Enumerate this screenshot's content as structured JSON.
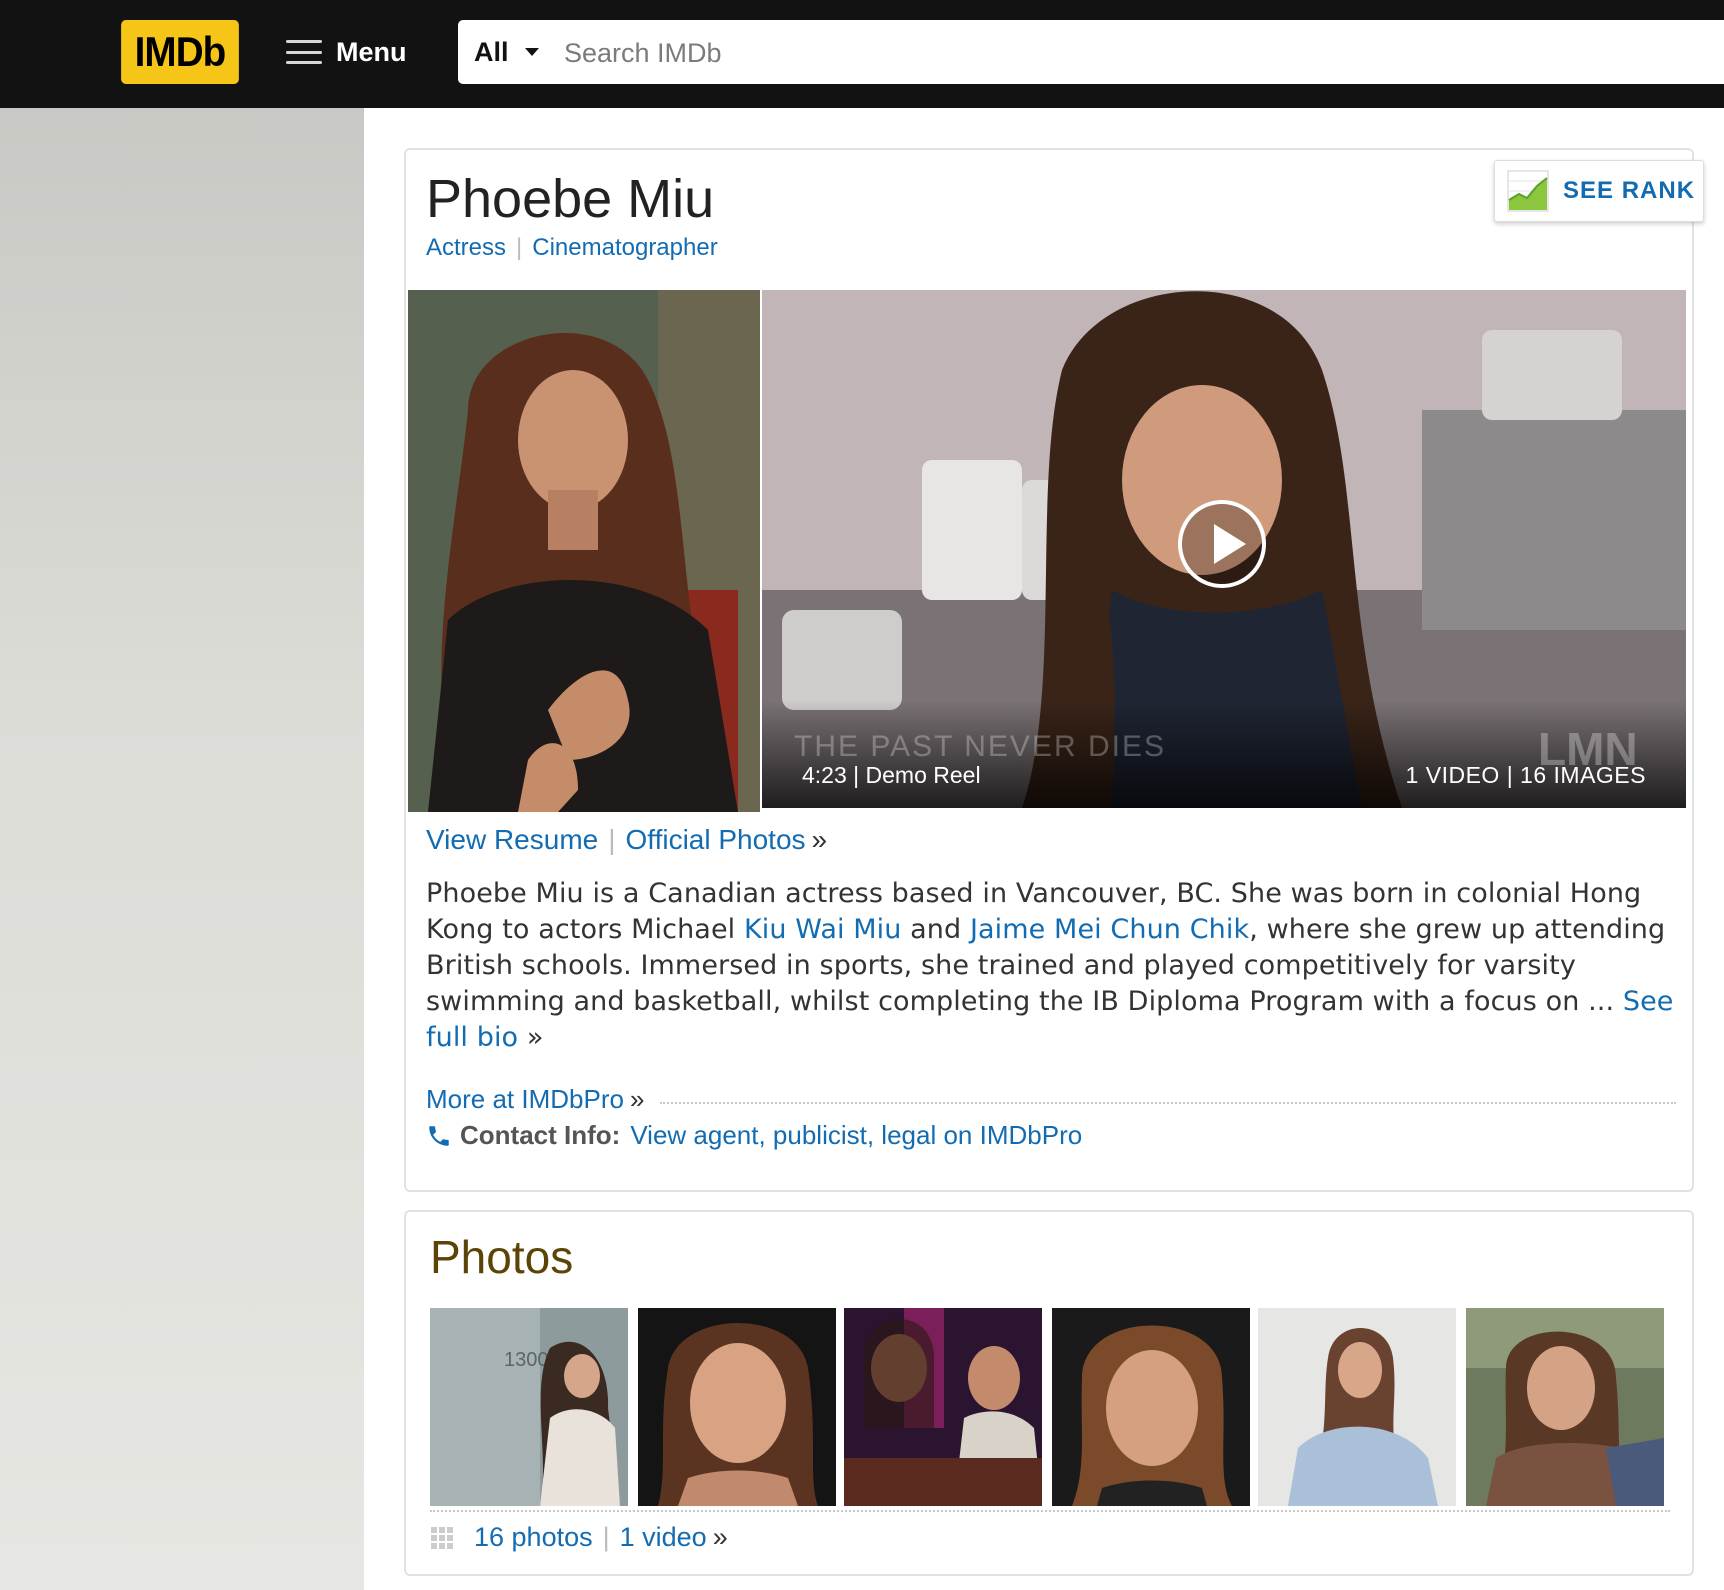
{
  "header": {
    "logo_text": "IMDb",
    "menu_label": "Menu",
    "search_category": "All",
    "search_placeholder": "Search IMDb"
  },
  "person": {
    "name": "Phoebe Miu",
    "roles": [
      "Actress",
      "Cinematographer"
    ],
    "see_rank_label": "SEE RANK"
  },
  "media": {
    "video_meta": "4:23 | Demo Reel",
    "video_count": "1 VIDEO | 16 IMAGES",
    "watermark": "THE PAST NEVER DIES",
    "network": "LMN",
    "view_resume": "View Resume",
    "official_photos": "Official Photos",
    "raquo": "»"
  },
  "bio": {
    "t1": "Phoebe Miu is a Canadian actress based in Vancouver, BC. She was born in colonial Hong Kong to actors Michael ",
    "link1": "Kiu Wai Miu",
    "t2": " and ",
    "link2": "Jaime Mei Chun Chik",
    "t3": ", where she grew up attending British schools. Immersed in sports, she trained and played competitively for varsity swimming and basketball, whilst completing the IB Diploma Program with a focus on ... ",
    "see_full_bio": "See full bio",
    "raquo": "»"
  },
  "pro": {
    "more_label": "More at IMDbPro",
    "raquo": "»",
    "contact_label": "Contact Info:",
    "contact_link": "View agent, publicist, legal on IMDbPro"
  },
  "photos": {
    "title": "Photos",
    "photos_link": "16 photos",
    "video_link": "1 video",
    "raquo": "»",
    "thumb_caption": "1300"
  },
  "colors": {
    "imdb_yellow": "#f5c518",
    "link_blue": "#136cb2",
    "header_bg": "#121212",
    "section_title": "#5c4407"
  }
}
